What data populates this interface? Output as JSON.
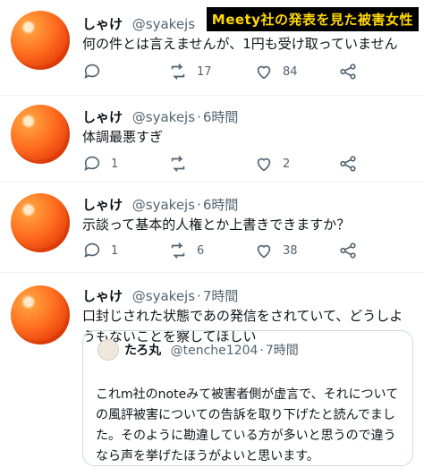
{
  "banner": "Meety社の発表を見た被害女性",
  "tweets": [
    {
      "name": "しゃけ",
      "handle": "@syakejs",
      "time": "",
      "text": "何の件とは言えませんが、1円も受け取っていません",
      "replies": "",
      "retweets": "17",
      "likes": "84"
    },
    {
      "name": "しゃけ",
      "handle": "@syakejs",
      "time": "6時間",
      "text": "体調最悪すぎ",
      "replies": "1",
      "retweets": "",
      "likes": "2"
    },
    {
      "name": "しゃけ",
      "handle": "@syakejs",
      "time": "6時間",
      "text": "示談って基本的人権とか上書きできますか？",
      "replies": "1",
      "retweets": "6",
      "likes": "38"
    },
    {
      "name": "しゃけ",
      "handle": "@syakejs",
      "time": "7時間",
      "text": "口封じされた状態であの発信をされていて、どうしようもないことを察してほしい",
      "quote": {
        "name": "たろ丸",
        "handle": "@tenche1204",
        "time": "7時間",
        "text": "これm社のnoteみて被害者側が虚言で、それについての風評被害についての告訴を取り下げたと読んでました。そのように勘違している方が多いと思うので違うなら声を挙げたほうがよいと思います。"
      }
    }
  ],
  "icons": [
    "reply-icon",
    "retweet-icon",
    "like-icon",
    "share-icon"
  ]
}
